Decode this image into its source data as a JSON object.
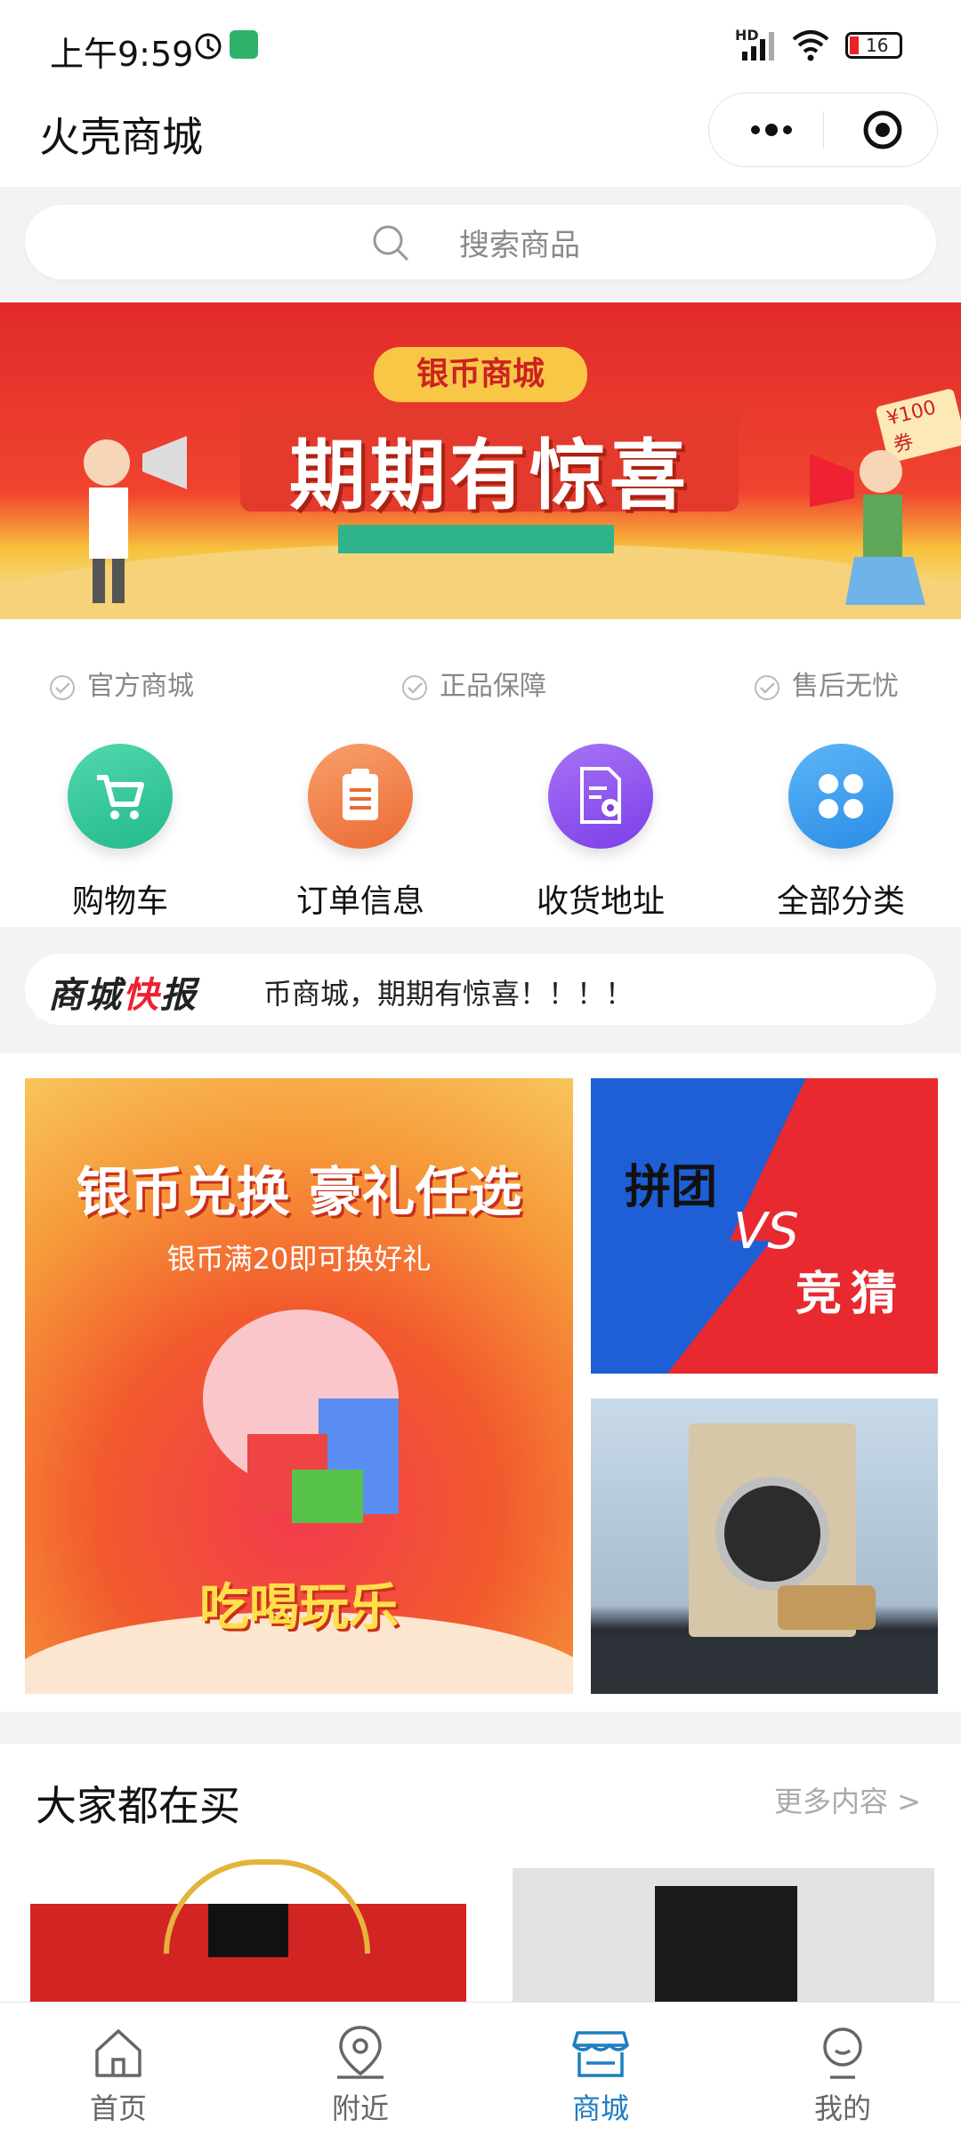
{
  "status_bar": {
    "time": "上午9:59",
    "battery": "16",
    "network": "HD"
  },
  "header": {
    "title": "火壳商城"
  },
  "search": {
    "placeholder": "搜索商品"
  },
  "banner": {
    "tag": "银币商城",
    "title": "期期有惊喜",
    "coupon": "¥100券"
  },
  "features": [
    {
      "label": "官方商城"
    },
    {
      "label": "正品保障"
    },
    {
      "label": "售后无忧"
    }
  ],
  "quick_entries": [
    {
      "label": "购物车",
      "icon": "cart-icon",
      "color": "#33c29a"
    },
    {
      "label": "订单信息",
      "icon": "clipboard-icon",
      "color": "#f07a3c"
    },
    {
      "label": "收货地址",
      "icon": "address-icon",
      "color": "#8c4ef0"
    },
    {
      "label": "全部分类",
      "icon": "grid-icon",
      "color": "#3a9ef2"
    }
  ],
  "news": {
    "logo_prefix": "商城",
    "logo_highlight": "快",
    "logo_suffix": "报",
    "text": "币商城，期期有惊喜！！！！"
  },
  "promo": {
    "left_title": "银币兑换 豪礼任选",
    "left_sub": "银币满20即可换好礼",
    "left_bottom": "吃喝玩乐",
    "right_top_left": "拼团",
    "right_top_vs": "VS",
    "right_top_right": "竞猜"
  },
  "hot": {
    "title": "大家都在买",
    "more": "更多内容 >"
  },
  "tabbar": [
    {
      "label": "首页",
      "icon": "home-icon",
      "active": false
    },
    {
      "label": "附近",
      "icon": "location-icon",
      "active": false
    },
    {
      "label": "商城",
      "icon": "store-icon",
      "active": true
    },
    {
      "label": "我的",
      "icon": "profile-icon",
      "active": false
    }
  ],
  "colors": {
    "accent": "#1d7ec0",
    "brand_red": "#e12a2a"
  }
}
